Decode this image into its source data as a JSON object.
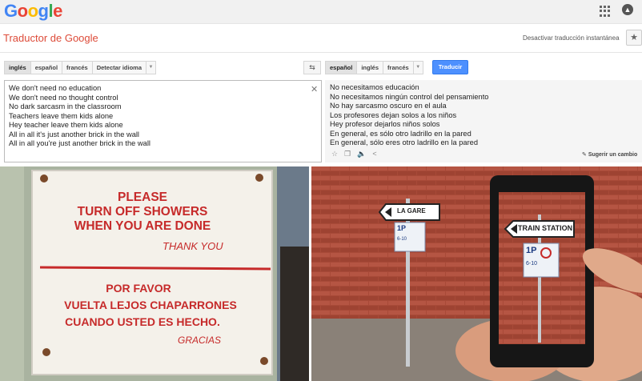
{
  "header": {
    "logo": "Google"
  },
  "title": "Traductor de Google",
  "instant_toggle": "Desactivar traducción instantánea",
  "source_langs": [
    "inglés",
    "español",
    "francés",
    "Detectar idioma"
  ],
  "target_langs": [
    "español",
    "inglés",
    "francés"
  ],
  "translate_button": "Traducir",
  "source_text": [
    "We don't need no education",
    "We don't need no thought control",
    "No dark sarcasm in the classroom",
    "Teachers leave them kids alone",
    "Hey teacher leave them kids alone",
    "All in all it's just another brick in the wall",
    "All in all you're just another brick in the wall"
  ],
  "translated_text": [
    "No necesitamos educación",
    "No necesitamos ningún control del pensamiento",
    "No hay sarcasmo oscuro en el aula",
    "Los profesores dejan solos a los niños",
    "Hey profesor dejarlos niños solos",
    "En general, es sólo otro ladrillo en la pared",
    "En general, sólo eres otro ladrillo en la pared"
  ],
  "suggest_edit": "Sugerir un cambio",
  "sign": {
    "line1": "PLEASE",
    "line2": "TURN OFF SHOWERS",
    "line3": "WHEN YOU ARE DONE",
    "thanks": "THANK YOU",
    "es1": "POR FAVOR",
    "es2": "VUELTA LEJOS CHAPARRONES",
    "es3": "CUANDO USTED ES HECHO.",
    "gracias": "GRACIAS"
  },
  "street_signs": {
    "la_gare": "LA GARE",
    "train_station": "TRAIN STATION",
    "parking": "1P",
    "parking_hours": "6-10"
  }
}
